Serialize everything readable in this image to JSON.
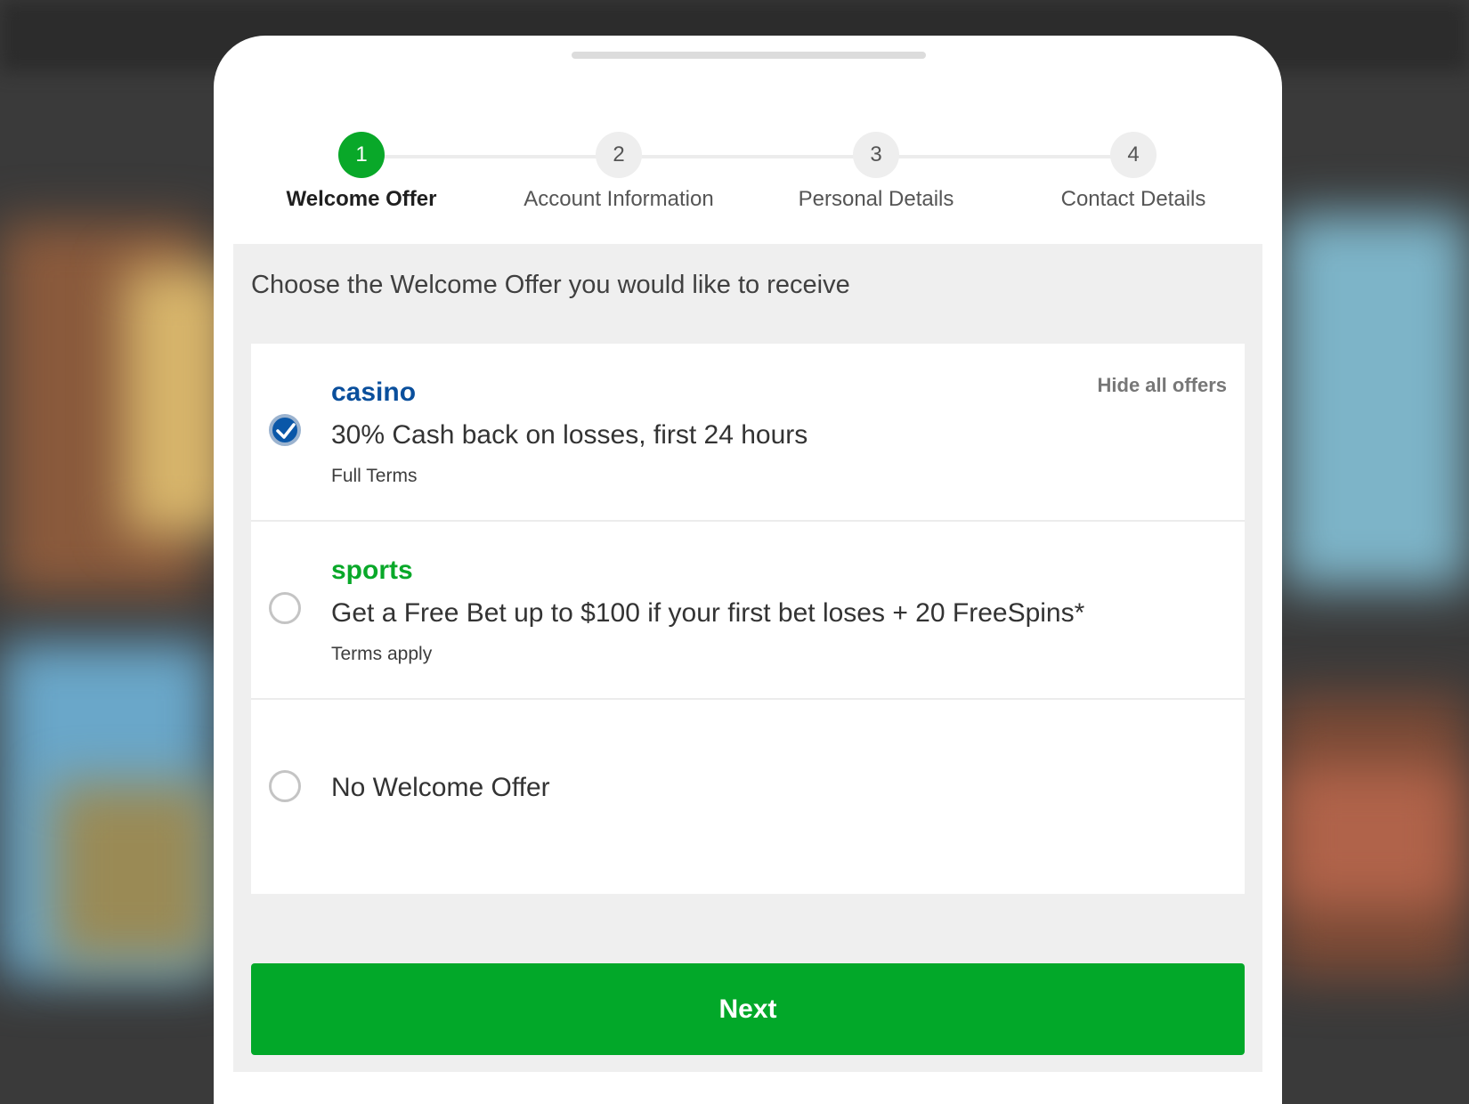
{
  "stepper": {
    "steps": [
      {
        "number": "1",
        "label": "Welcome Offer",
        "active": true
      },
      {
        "number": "2",
        "label": "Account Information",
        "active": false
      },
      {
        "number": "3",
        "label": "Personal Details",
        "active": false
      },
      {
        "number": "4",
        "label": "Contact Details",
        "active": false
      }
    ]
  },
  "panel": {
    "instruction": "Choose the Welcome Offer you would like to receive",
    "hide_offers_label": "Hide all offers",
    "offers": [
      {
        "brand": "casino",
        "description": "30% Cash back on losses, first 24 hours",
        "terms": "Full Terms",
        "selected": true
      },
      {
        "brand": "sports",
        "description": "Get a Free Bet up to $100 if your first bet loses + 20 FreeSpins*",
        "terms": "Terms apply",
        "selected": false
      },
      {
        "brand": "",
        "description": "No Welcome Offer",
        "terms": "",
        "selected": false
      }
    ],
    "next_label": "Next"
  },
  "colors": {
    "accent_green": "#02a829",
    "casino_blue": "#0a4f9c",
    "selected_radio": "#0a57a8"
  }
}
